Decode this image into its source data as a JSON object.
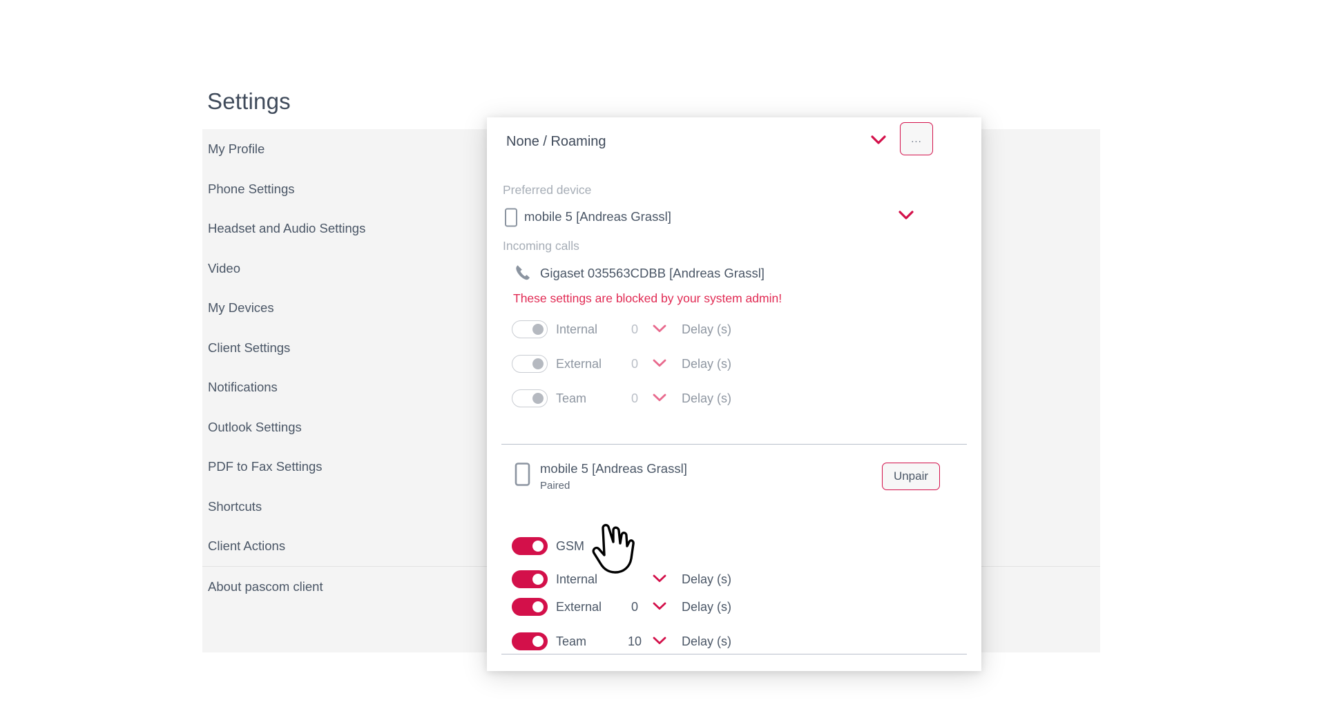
{
  "page": {
    "title": "Settings",
    "nav_items": [
      {
        "label": "My Profile"
      },
      {
        "label": "Phone Settings"
      },
      {
        "label": "Headset and Audio Settings"
      },
      {
        "label": "Video"
      },
      {
        "label": "My Devices"
      },
      {
        "label": "Client Settings"
      },
      {
        "label": "Notifications"
      },
      {
        "label": "Outlook Settings"
      },
      {
        "label": "PDF to Fax Settings"
      },
      {
        "label": "Shortcuts"
      },
      {
        "label": "Client Actions"
      },
      {
        "label": "About pascom client"
      }
    ]
  },
  "dialog": {
    "profile": {
      "label": "None / Roaming",
      "chevron_icon": "chevron-down-icon",
      "more_label": "...",
      "more_icon": "ellipsis-icon"
    },
    "preferred_device": {
      "caption": "Preferred device",
      "device_name": "mobile 5 [Andreas Grassl]",
      "device_icon": "mobile-phone-icon",
      "chevron_icon": "chevron-down-icon"
    },
    "incoming_calls": {
      "caption": "Incoming calls",
      "device_name": "Gigaset 035563CDBB [Andreas Grassl]",
      "device_icon": "phone-handset-icon",
      "blocked_message": "These settings are blocked by your system admin!",
      "rows": [
        {
          "label": "Internal",
          "delay": "0",
          "delay_caption": "Delay (s)",
          "enabled": false
        },
        {
          "label": "External",
          "delay": "0",
          "delay_caption": "Delay (s)",
          "enabled": false
        },
        {
          "label": "Team",
          "delay": "0",
          "delay_caption": "Delay (s)",
          "enabled": false
        }
      ]
    },
    "paired_device": {
      "name": "mobile 5 [Andreas Grassl]",
      "status": "Paired",
      "device_icon": "mobile-phone-icon",
      "unpair_label": "Unpair",
      "rows": [
        {
          "label": "GSM",
          "delay": "",
          "delay_caption": "",
          "enabled": true
        },
        {
          "label": "Internal",
          "delay": "",
          "delay_caption": "Delay (s)",
          "enabled": true
        },
        {
          "label": "External",
          "delay": "0",
          "delay_caption": "Delay (s)",
          "enabled": true
        },
        {
          "label": "Team",
          "delay": "10",
          "delay_caption": "Delay (s)",
          "enabled": true
        }
      ]
    }
  },
  "colors": {
    "accent": "#d3104a",
    "warning_text": "#e12a53",
    "panel_background": "#f4f4f4",
    "body_text": "#4a5666",
    "muted_text": "#a6adb6"
  },
  "cursor": {
    "icon": "pointing-hand-cursor"
  }
}
